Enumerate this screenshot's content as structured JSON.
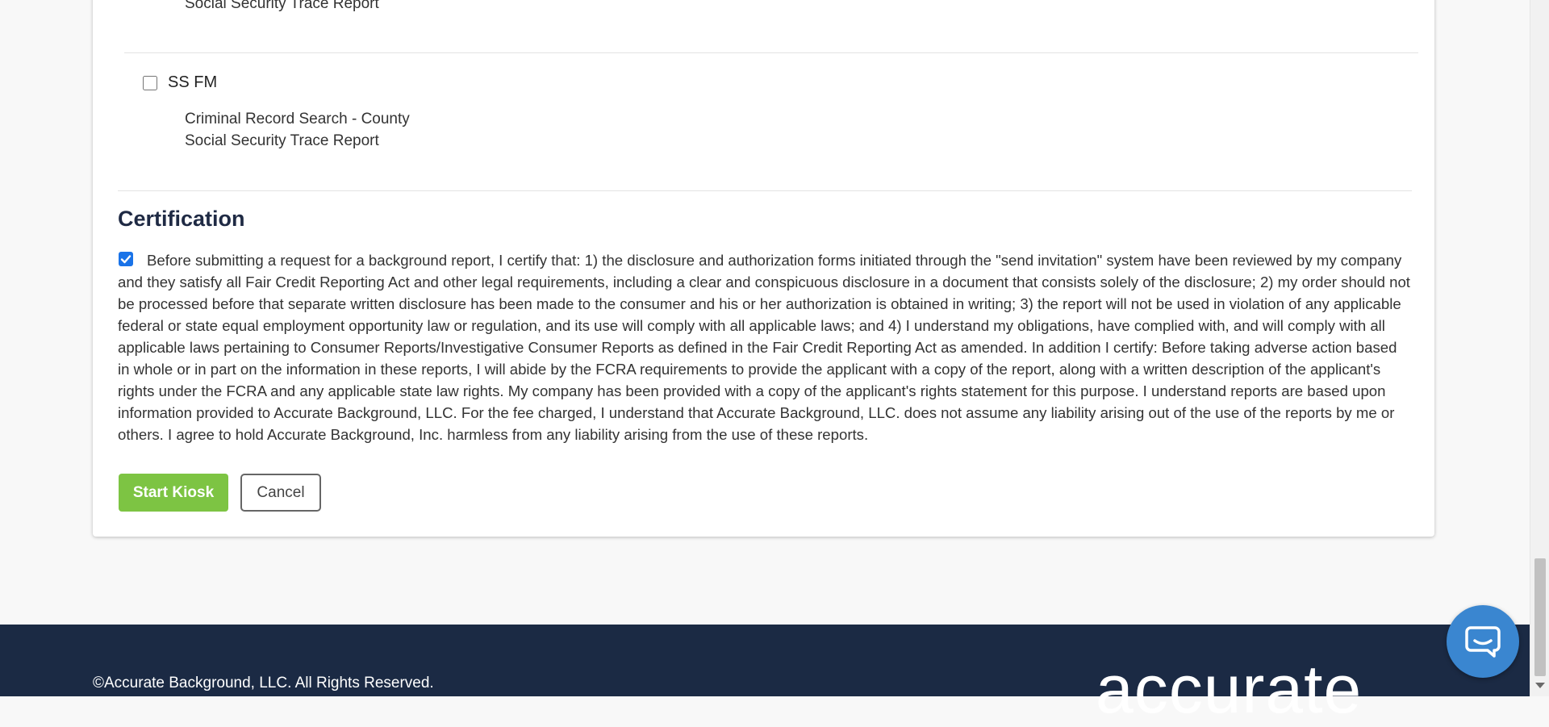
{
  "packages": {
    "previous_last_item": "Social Security Trace Report",
    "items": [
      {
        "name": "SS FM",
        "checked": false,
        "includes": [
          "Criminal Record Search - County",
          "Social Security Trace Report"
        ]
      }
    ]
  },
  "certification": {
    "heading": "Certification",
    "checked": true,
    "text": "Before submitting a request for a background report, I certify that: 1) the disclosure and authorization forms initiated through the \"send invitation\" system have been reviewed by my company and they satisfy all Fair Credit Reporting Act and other legal requirements, including a clear and conspicuous disclosure in a document that consists solely of the disclosure; 2) my order should not be processed before that separate written disclosure has been made to the consumer and his or her authorization is obtained in writing; 3) the report will not be used in violation of any applicable federal or state equal employment opportunity law or regulation, and its use will comply with all applicable laws; and 4) I understand my obligations, have complied with, and will comply with all applicable laws pertaining to Consumer Reports/Investigative Consumer Reports as defined in the Fair Credit Reporting Act as amended. In addition I certify: Before taking adverse action based in whole or in part on the information in these reports, I will abide by the FCRA requirements to provide the applicant with a copy of the report, along with a written description of the applicant's rights under the FCRA and any applicable state law rights. My company has been provided with a copy of the applicant's rights statement for this purpose. I understand reports are based upon information provided to Accurate Background, LLC. For the fee charged, I understand that Accurate Background, LLC. does not assume any liability arising out of the use of the reports by me or others. I agree to hold Accurate Background, Inc. harmless from any liability arising from the use of these reports."
  },
  "actions": {
    "start_label": "Start Kiosk",
    "cancel_label": "Cancel"
  },
  "footer": {
    "copyright": "©Accurate Background, LLC. All Rights Reserved.",
    "logo_text": "accurate"
  },
  "colors": {
    "primary_button": "#7dc443",
    "footer_bg": "#1b2a44",
    "chat_bubble": "#3a86d0",
    "checkbox_checked": "#1a73e8"
  },
  "icons": {
    "chat": "chat-bubble-icon",
    "checkmark": "checkmark-icon"
  }
}
